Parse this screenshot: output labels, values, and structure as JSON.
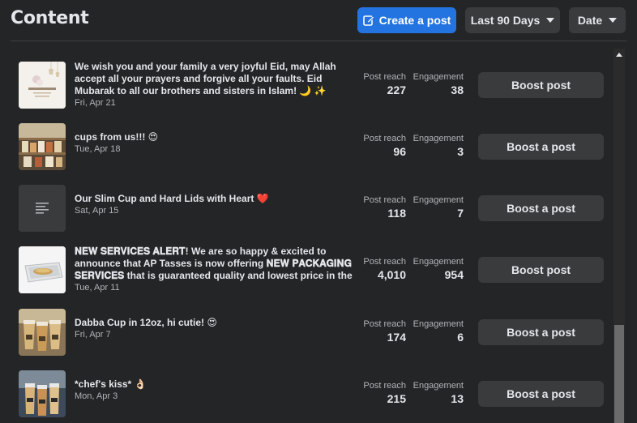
{
  "header": {
    "title": "Content",
    "create_label": "Create a post",
    "range_label": "Last 90 Days",
    "sort_label": "Date"
  },
  "posts": [
    {
      "caption": "We wish you and your family a very joyful Eid, may Allah accept all your prayers and forgive all your faults. Eid Mubarak to all our brothers and sisters in Islam! 🌙 ✨",
      "date": "Fri, Apr 21",
      "reach_label": "Post reach",
      "reach": "227",
      "engagement_label": "Engagement",
      "engagement": "38",
      "boost_label": "Boost post",
      "thumb": "eid-mubarak-card"
    },
    {
      "caption": "cups from us!!! 😍",
      "date": "Tue, Apr 18",
      "reach_label": "Post reach",
      "reach": "96",
      "engagement_label": "Engagement",
      "engagement": "3",
      "boost_label": "Boost a post",
      "thumb": "cups-shelf-photo"
    },
    {
      "caption": "Our Slim Cup and Hard Lids with Heart ❤️",
      "date": "Sat, Apr 15",
      "reach_label": "Post reach",
      "reach": "118",
      "engagement_label": "Engagement",
      "engagement": "7",
      "boost_label": "Boost a post",
      "thumb": "text-lines-icon"
    },
    {
      "caption": "𝐍𝐄𝐖 𝐒𝐄𝐑𝐕𝐈𝐂𝐄𝐒 𝐀𝐋𝐄𝐑𝐓! We are so happy & excited to announce that AP Tasses is now offering 𝐍𝐄𝐖 𝐏𝐀𝐂𝐊𝐀𝐆𝐈𝐍𝐆 𝐒𝐄𝐑𝐕𝐈𝐂𝐄𝐒 that is guaranteed quality and lowest price in the market! ❤️🔥 ✦...",
      "date": "Tue, Apr 11",
      "reach_label": "Post reach",
      "reach": "4,010",
      "engagement_label": "Engagement",
      "engagement": "954",
      "boost_label": "Boost post",
      "thumb": "packaging-tray-photo"
    },
    {
      "caption": "Dabba Cup in 12oz, hi cutie! 😍",
      "date": "Fri, Apr 7",
      "reach_label": "Post reach",
      "reach": "174",
      "engagement_label": "Engagement",
      "engagement": "6",
      "boost_label": "Boost a post",
      "thumb": "dabba-cups-photo"
    },
    {
      "caption": "*chef's kiss* 👌🏻",
      "date": "Mon, Apr 3",
      "reach_label": "Post reach",
      "reach": "215",
      "engagement_label": "Engagement",
      "engagement": "13",
      "boost_label": "Boost a post",
      "thumb": "drinks-photo"
    }
  ],
  "colors": {
    "background": "#242526",
    "accent": "#2374e1",
    "button": "#3a3b3c",
    "text_primary": "#e4e6eb",
    "text_secondary": "#b0b3b8"
  },
  "icons": {
    "create": "edit-pencil-icon",
    "dropdown": "caret-down-icon",
    "scroll": "scroll-up-arrow-icon"
  }
}
